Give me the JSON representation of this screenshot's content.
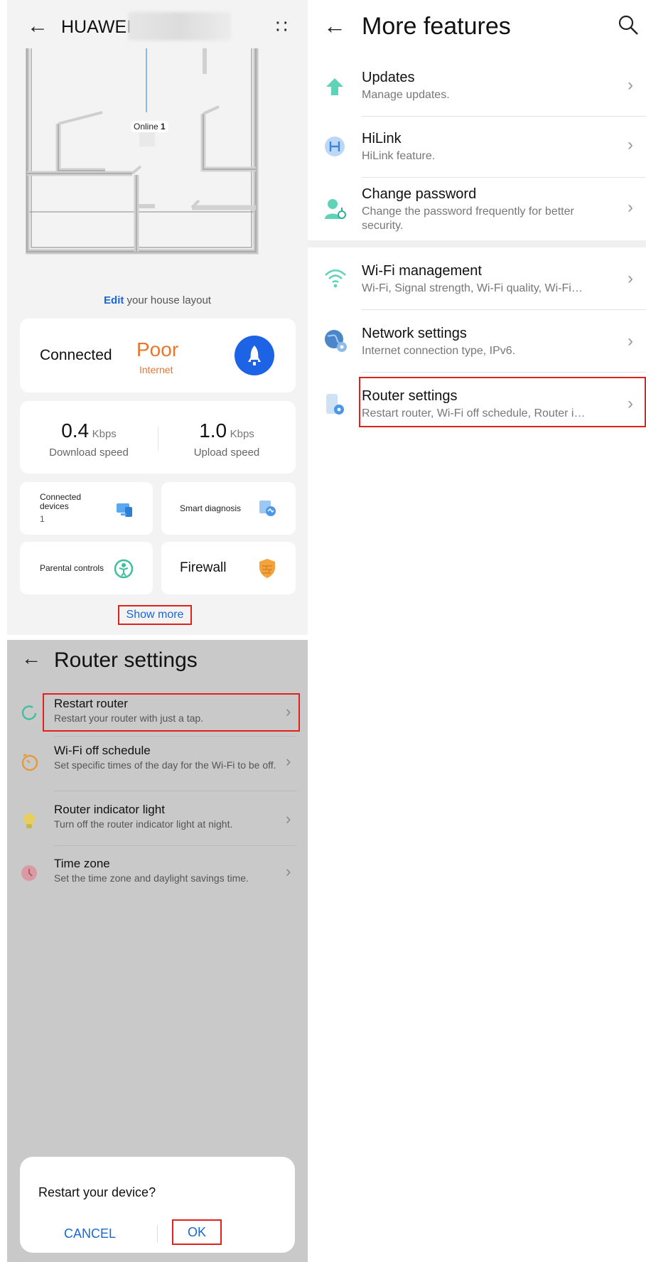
{
  "panel1": {
    "title": "HUAWEI",
    "online_label": "Online",
    "online_count": "1",
    "edit_link": "Edit",
    "edit_suffix": "your house layout",
    "status": {
      "connected": "Connected",
      "quality": "Poor",
      "quality_sub": "Internet"
    },
    "speed": {
      "download_value": "0.4",
      "download_unit": "Kbps",
      "download_label": "Download speed",
      "upload_value": "1.0",
      "upload_unit": "Kbps",
      "upload_label": "Upload speed"
    },
    "tiles": {
      "connected_devices": "Connected devices",
      "connected_count": "1",
      "smart_diagnosis": "Smart diagnosis",
      "parental_controls": "Parental controls",
      "firewall": "Firewall"
    },
    "show_more": "Show more"
  },
  "panel2": {
    "title": "More features",
    "items": [
      {
        "name": "Updates",
        "desc": "Manage updates."
      },
      {
        "name": "HiLink",
        "desc": "HiLink feature."
      },
      {
        "name": "Change password",
        "desc": "Change the password frequently for better security."
      },
      {
        "name": "Wi-Fi management",
        "desc": "Wi-Fi, Signal strength, Wi-Fi quality, Wi-Fi…"
      },
      {
        "name": "Network settings",
        "desc": "Internet connection type, IPv6."
      },
      {
        "name": "Router settings",
        "desc": "Restart router, Wi-Fi off schedule, Router i…"
      }
    ]
  },
  "panel3": {
    "title": "Router settings",
    "items": [
      {
        "name": "Restart router",
        "desc": "Restart your router with just a tap."
      },
      {
        "name": "Wi-Fi off schedule",
        "desc": "Set specific times of the day for the Wi-Fi to be off."
      },
      {
        "name": "Router indicator light",
        "desc": "Turn off the router indicator light at night."
      },
      {
        "name": "Time zone",
        "desc": "Set the time zone and daylight savings time."
      }
    ],
    "dialog": {
      "question": "Restart your device?",
      "cancel": "CANCEL",
      "ok": "OK"
    }
  },
  "colors": {
    "accent": "#1a66d9",
    "highlight": "#e0211c",
    "poor": "#e8762f"
  }
}
